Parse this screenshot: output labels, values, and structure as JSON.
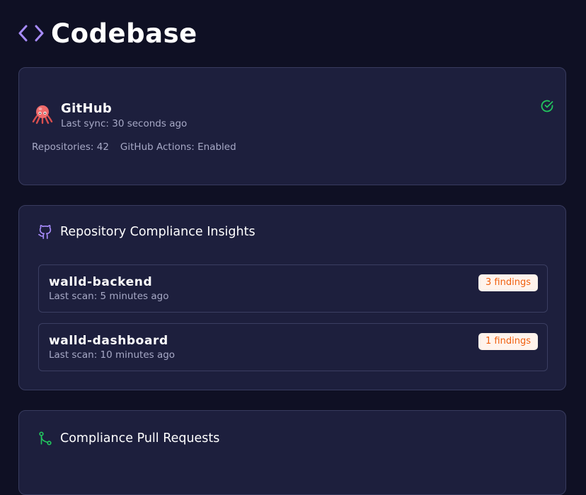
{
  "header": {
    "title": "Codebase",
    "icon": "code-brackets-icon",
    "icon_color": "#a78bfa"
  },
  "github": {
    "name": "GitHub",
    "last_sync": "Last sync: 30 seconds ago",
    "repositories": "Repositories: 42",
    "actions": "GitHub Actions: Enabled",
    "status_icon": "check-circle-icon",
    "status_color": "#22c55e"
  },
  "repo_insights": {
    "title": "Repository Compliance Insights",
    "icon": "github-icon",
    "items": [
      {
        "name": "walld-backend",
        "last_scan": "Last scan: 5 minutes ago",
        "findings": "3 findings"
      },
      {
        "name": "walld-dashboard",
        "last_scan": "Last scan: 10 minutes ago",
        "findings": "1 findings"
      }
    ]
  },
  "pull_requests": {
    "title": "Compliance Pull Requests",
    "icon": "git-pull-request-icon",
    "icon_color": "#22c55e"
  },
  "colors": {
    "background": "#0f1024",
    "card": "#1d1f3d",
    "border": "#383b5e",
    "badge_bg": "#fff3ec",
    "badge_text": "#f0600f"
  }
}
